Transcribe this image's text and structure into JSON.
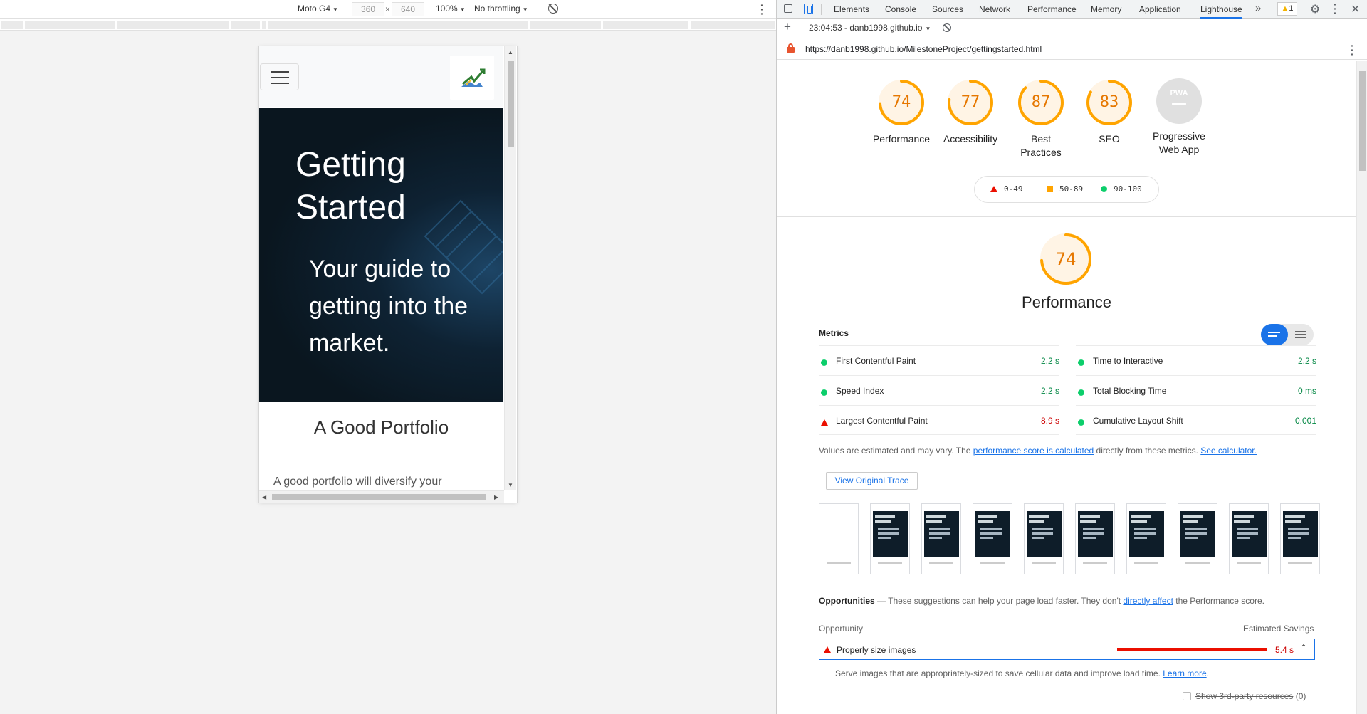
{
  "device_toolbar": {
    "device": "Moto G4",
    "width": "360",
    "times": "×",
    "height": "640",
    "zoom": "100%",
    "throttling": "No throttling"
  },
  "site": {
    "hero_title": "Getting Started",
    "hero_subtitle": "Your guide to getting into the market.",
    "section_title": "A Good Portfolio",
    "section_text": "A good portfolio will diversify your"
  },
  "devtools": {
    "tabs": [
      {
        "label": "Elements"
      },
      {
        "label": "Console"
      },
      {
        "label": "Sources"
      },
      {
        "label": "Network"
      },
      {
        "label": "Performance"
      },
      {
        "label": "Memory"
      },
      {
        "label": "Application"
      },
      {
        "label": "Lighthouse",
        "active": true
      }
    ],
    "more_tabs": "»",
    "warning_count": "1",
    "report_select": "23:04:53 - danb1998.github.io",
    "url": "https://danb1998.github.io/MilestoneProject/gettingstarted.html"
  },
  "scores": [
    {
      "label": "Performance",
      "score": 74
    },
    {
      "label": "Accessibility",
      "score": 77
    },
    {
      "label": "Best Practices",
      "score": 87
    },
    {
      "label": "SEO",
      "score": 83
    },
    {
      "label": "Progressive Web App",
      "score": null,
      "badge": "PWA"
    }
  ],
  "legend": [
    {
      "range": "0-49",
      "color": "#eb0f00"
    },
    {
      "range": "50-89",
      "color": "#ffa400"
    },
    {
      "range": "90-100",
      "color": "#0cce6b"
    }
  ],
  "performance": {
    "score": 74,
    "title": "Performance",
    "metrics_label": "Metrics",
    "metrics": [
      {
        "name": "First Contentful Paint",
        "value": "2.2 s",
        "status": "pass"
      },
      {
        "name": "Time to Interactive",
        "value": "2.2 s",
        "status": "pass"
      },
      {
        "name": "Speed Index",
        "value": "2.2 s",
        "status": "pass"
      },
      {
        "name": "Total Blocking Time",
        "value": "0 ms",
        "status": "pass"
      },
      {
        "name": "Largest Contentful Paint",
        "value": "8.9 s",
        "status": "fail"
      },
      {
        "name": "Cumulative Layout Shift",
        "value": "0.001",
        "status": "pass"
      }
    ],
    "note_prefix": "Values are estimated and may vary. The ",
    "note_link1": "performance score is calculated",
    "note_middle": " directly from these metrics. ",
    "note_link2": "See calculator.",
    "trace_button": "View Original Trace",
    "filmstrip_frames": 10
  },
  "opportunities": {
    "heading": "Opportunities",
    "dash": " — ",
    "intro": "These suggestions can help your page load faster. They don't ",
    "intro_link": "directly affect",
    "intro_suffix": " the Performance score.",
    "col_left": "Opportunity",
    "col_right": "Estimated Savings",
    "items": [
      {
        "title": "Properly size images",
        "savings": "5.4 s"
      }
    ],
    "desc": "Serve images that are appropriately-sized to save cellular data and improve load time. ",
    "desc_link": "Learn more",
    "third_party_label": "Show 3rd-party resources",
    "third_party_count": "(0)"
  },
  "colors": {
    "average": "#ffa400",
    "average_text": "#e67700",
    "pass": "#0cce6b",
    "fail": "#eb0f00",
    "accent": "#1a73e8"
  }
}
